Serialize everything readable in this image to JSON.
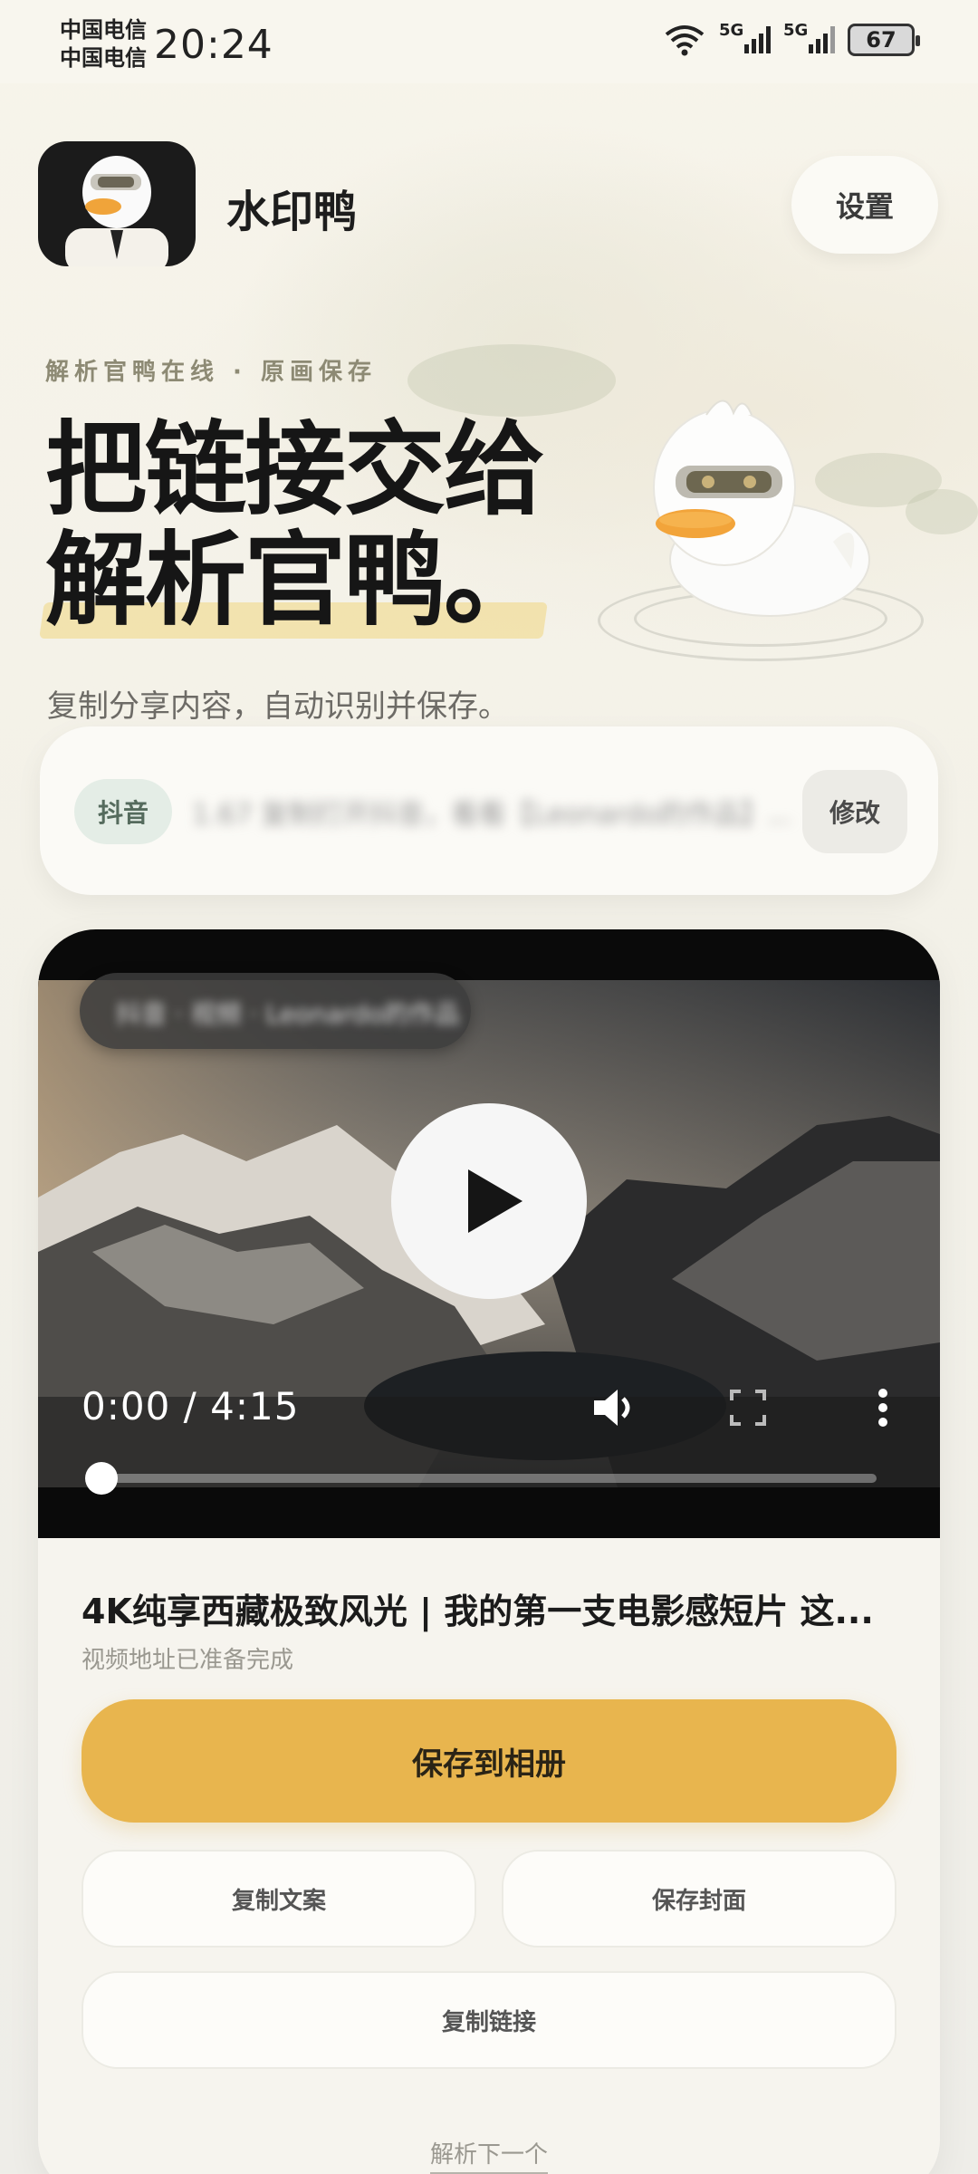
{
  "status_bar": {
    "carrier_1": "中国电信",
    "carrier_2": "中国电信",
    "time": "20:24",
    "signal_1_label": "5G",
    "signal_2_label": "5G",
    "battery": "67"
  },
  "header": {
    "app_name": "水印鸭",
    "settings_label": "设置"
  },
  "hero": {
    "kicker": "解析官鸭在线 · 原画保存",
    "headline_line1": "把链接交给",
    "headline_line2": "解析官鸭。",
    "subtitle": "复制分享内容，自动识别并保存。"
  },
  "link_card": {
    "platform": "抖音",
    "link_text": "1.67 复制打开抖音，看看【Leonardo的作品】...",
    "edit_label": "修改"
  },
  "video": {
    "author": "抖音 · 视频 · Leonardo的作品",
    "time_readout": "0:00 / 4:15",
    "progress": 0,
    "title": "4K纯享西藏极致风光 | 我的第一支电影感短片 这...",
    "status": "视频地址已准备完成"
  },
  "actions": {
    "save_label": "保存到相册",
    "copy_text_label": "复制文案",
    "save_cover_label": "保存封面",
    "copy_link_label": "复制链接",
    "next_label": "解析下一个"
  },
  "colors": {
    "accent": "#e8b54e",
    "badge_bg": "#e4ede6",
    "background": "#f3f1e8"
  },
  "icons": [
    "wifi-icon",
    "signal-icon",
    "battery-icon",
    "play-icon",
    "volume-icon",
    "fullscreen-icon",
    "more-icon",
    "duck-mascot-icon"
  ]
}
